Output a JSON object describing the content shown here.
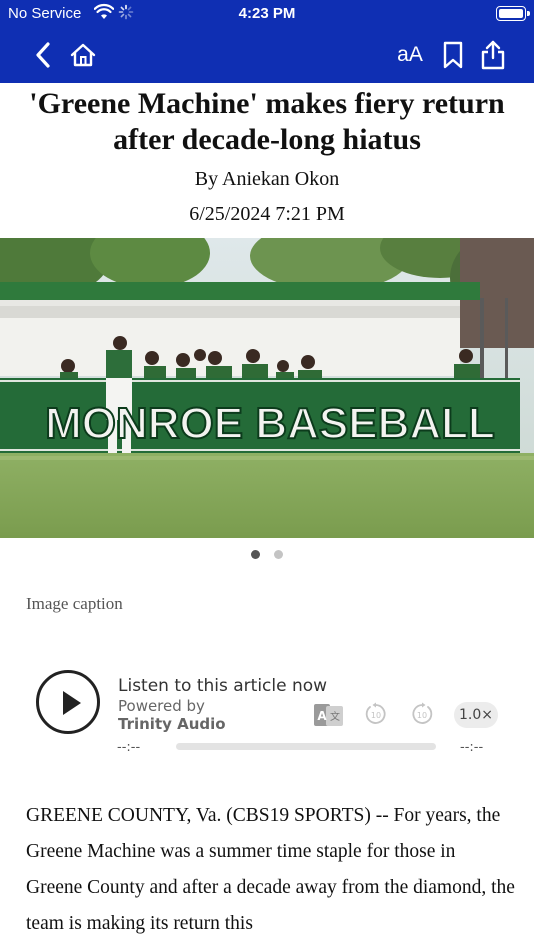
{
  "status_bar": {
    "carrier": "No Service",
    "time": "4:23 PM"
  },
  "nav": {
    "text_size_label": "aA",
    "icons": [
      "chevron-left-icon",
      "home-icon",
      "bookmark-icon",
      "share-icon"
    ],
    "background_color": "#0f2fb3"
  },
  "article": {
    "headline": "'Greene Machine' makes fiery return after decade-long hiatus",
    "byline": "By Aniekan Okon",
    "date": "6/25/2024 7:21 PM",
    "image_caption": "Image caption",
    "image_banner_text": "MONROE BASEBALL",
    "gallery": {
      "count": 2,
      "active_index": 0
    },
    "body": "GREENE COUNTY, Va. (CBS19 SPORTS) -- For years, the Greene Machine was a summer time staple for those in Greene County and after a decade away from the diamond, the team is making its return this"
  },
  "audio_player": {
    "title": "Listen to this article now",
    "powered_by": "Powered by",
    "brand": "Trinity Audio",
    "speed": "1.0×",
    "time_start": "--:--",
    "time_end": "--:--",
    "progress": 0
  }
}
